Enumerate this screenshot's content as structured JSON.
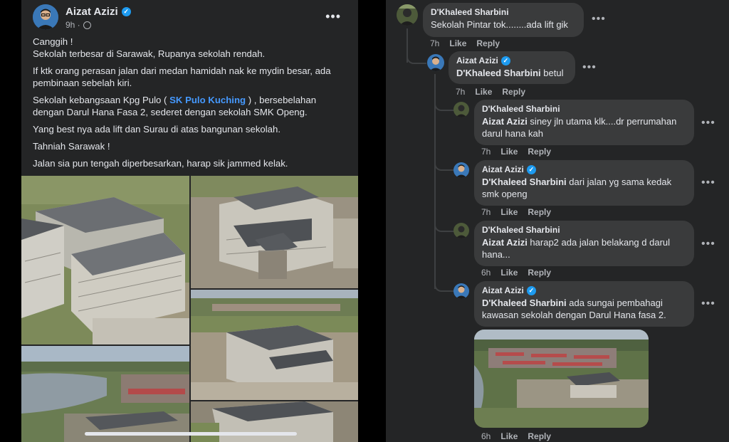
{
  "post": {
    "author": "Aizat Azizi",
    "time": "9h ·",
    "more_label": "•••",
    "paragraphs": {
      "p1_line1": "Canggih !",
      "p1_line2": "Sekolah terbesar di Sarawak, Rupanya sekolah rendah.",
      "p2": "If ktk orang perasan jalan dari medan hamidah nak ke mydin besar, ada pembinaan sebelah kiri.",
      "p3_before": "Sekolah kebangsaan Kpg Pulo ( ",
      "p3_link": "SK Pulo Kuching",
      "p3_after": " ) , bersebelahan dengan Darul Hana Fasa 2, sederet dengan sekolah SMK Openg.",
      "p4": "Yang best nya ada lift dan Surau di atas bangunan sekolah.",
      "p5": "Tahniah Sarawak !",
      "p6": "Jalan sia pun tengah diperbesarkan, harap sik jammed kelak."
    }
  },
  "comments": [
    {
      "name": "D'Khaleed Sharbini",
      "text": "Sekolah Pintar tok........ada lift gik",
      "time": "7h",
      "like": "Like",
      "reply": "Reply"
    },
    {
      "name": "Aizat Azizi",
      "mention": "D'Khaleed Sharbini",
      "text": " betul",
      "time": "7h",
      "like": "Like",
      "reply": "Reply"
    },
    {
      "name": "D'Khaleed Sharbini",
      "mention": "Aizat Azizi",
      "text_line1": " siney jln utama klk....dr perrumahan",
      "text_line2": "darul hana kah",
      "time": "7h",
      "like": "Like",
      "reply": "Reply"
    },
    {
      "name": "Aizat Azizi",
      "mention": "D'Khaleed Sharbini",
      "text_line1": " dari jalan yg sama kedak",
      "text_line2": "smk openg",
      "time": "7h",
      "like": "Like",
      "reply": "Reply"
    },
    {
      "name": "D'Khaleed Sharbini",
      "mention": "Aizat Azizi",
      "text_line1": " harap2 ada jalan belakang d darul",
      "text_line2": "hana...",
      "time": "6h",
      "like": "Like",
      "reply": "Reply"
    },
    {
      "name": "Aizat Azizi",
      "mention": "D'Khaleed Sharbini",
      "text_line1": " ada sungai pembahagi",
      "text_line2": "kawasan sekolah dengan Darul Hana fasa 2.",
      "time": "6h",
      "like": "Like",
      "reply": "Reply"
    }
  ],
  "more_label": "•••",
  "colors": {
    "bg": "#000000",
    "card": "#242526",
    "bubble": "#3a3b3c",
    "link": "#4599ff",
    "verified": "#1d9bf0"
  }
}
